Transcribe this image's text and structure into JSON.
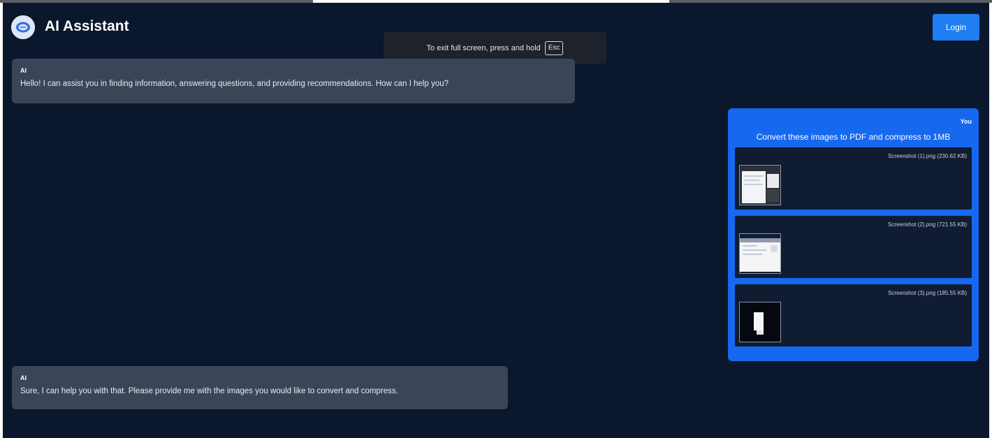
{
  "header": {
    "title": "AI Assistant",
    "logo_icon": "chat-bubble-icon",
    "login_label": "Login"
  },
  "fullscreen_toast": {
    "text": "To exit full screen, press and hold",
    "key": "Esc"
  },
  "messages": [
    {
      "sender": "AI",
      "text": "Hello! I can assist you in finding information, answering questions, and providing recommendations. How can I help you?"
    },
    {
      "sender": "You",
      "text": "Convert these images to PDF and compress to 1MB",
      "attachments": [
        {
          "filename": "Screenshot (1).png (230.62 KB)"
        },
        {
          "filename": "Screenshot (2).png (721.55 KB)"
        },
        {
          "filename": "Screenshot (3).png (185.55 KB)"
        }
      ]
    },
    {
      "sender": "AI",
      "text": "Sure, I can help you with that. Please provide me with the images you would like to convert and compress."
    }
  ],
  "colors": {
    "background": "#0b172c",
    "ai_bubble": "#3a4558",
    "user_bubble": "#1668ef",
    "login_button": "#1e7ef2"
  }
}
